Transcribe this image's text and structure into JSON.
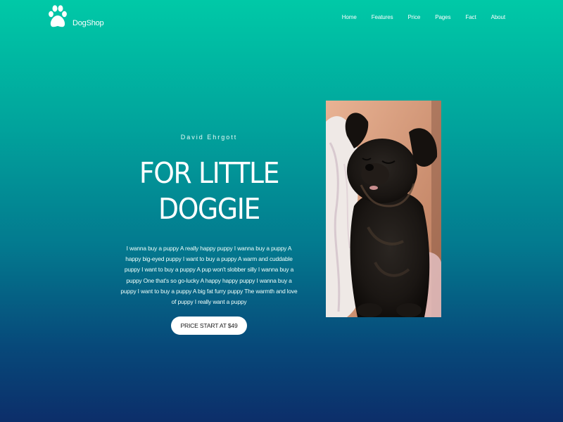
{
  "brand": {
    "name": "DogShop",
    "logo_icon": "paw-icon"
  },
  "nav": {
    "items": [
      "Home",
      "Features",
      "Price",
      "Pages",
      "Fact",
      "About"
    ]
  },
  "hero": {
    "author": "David Ehrgott",
    "title_line1": "FOR LITTLE",
    "title_line2": "DOGGIE",
    "description": "I wanna buy a puppy A really happy puppy I wanna buy a puppy A happy big-eyed puppy I want to buy a puppy A warm and cuddable puppy I want to buy a puppy A pup won't slobber silly I wanna buy a puppy One that's so go-lucky A happy happy puppy I wanna buy a puppy I want to buy a puppy A big fat furry puppy The warmth and love of puppy I really want a puppy",
    "cta_label": "PRICE START AT $49"
  },
  "colors": {
    "gradient_top": "#00c9a7",
    "gradient_bottom": "#0c2e6a",
    "button_bg": "#ffffff"
  }
}
